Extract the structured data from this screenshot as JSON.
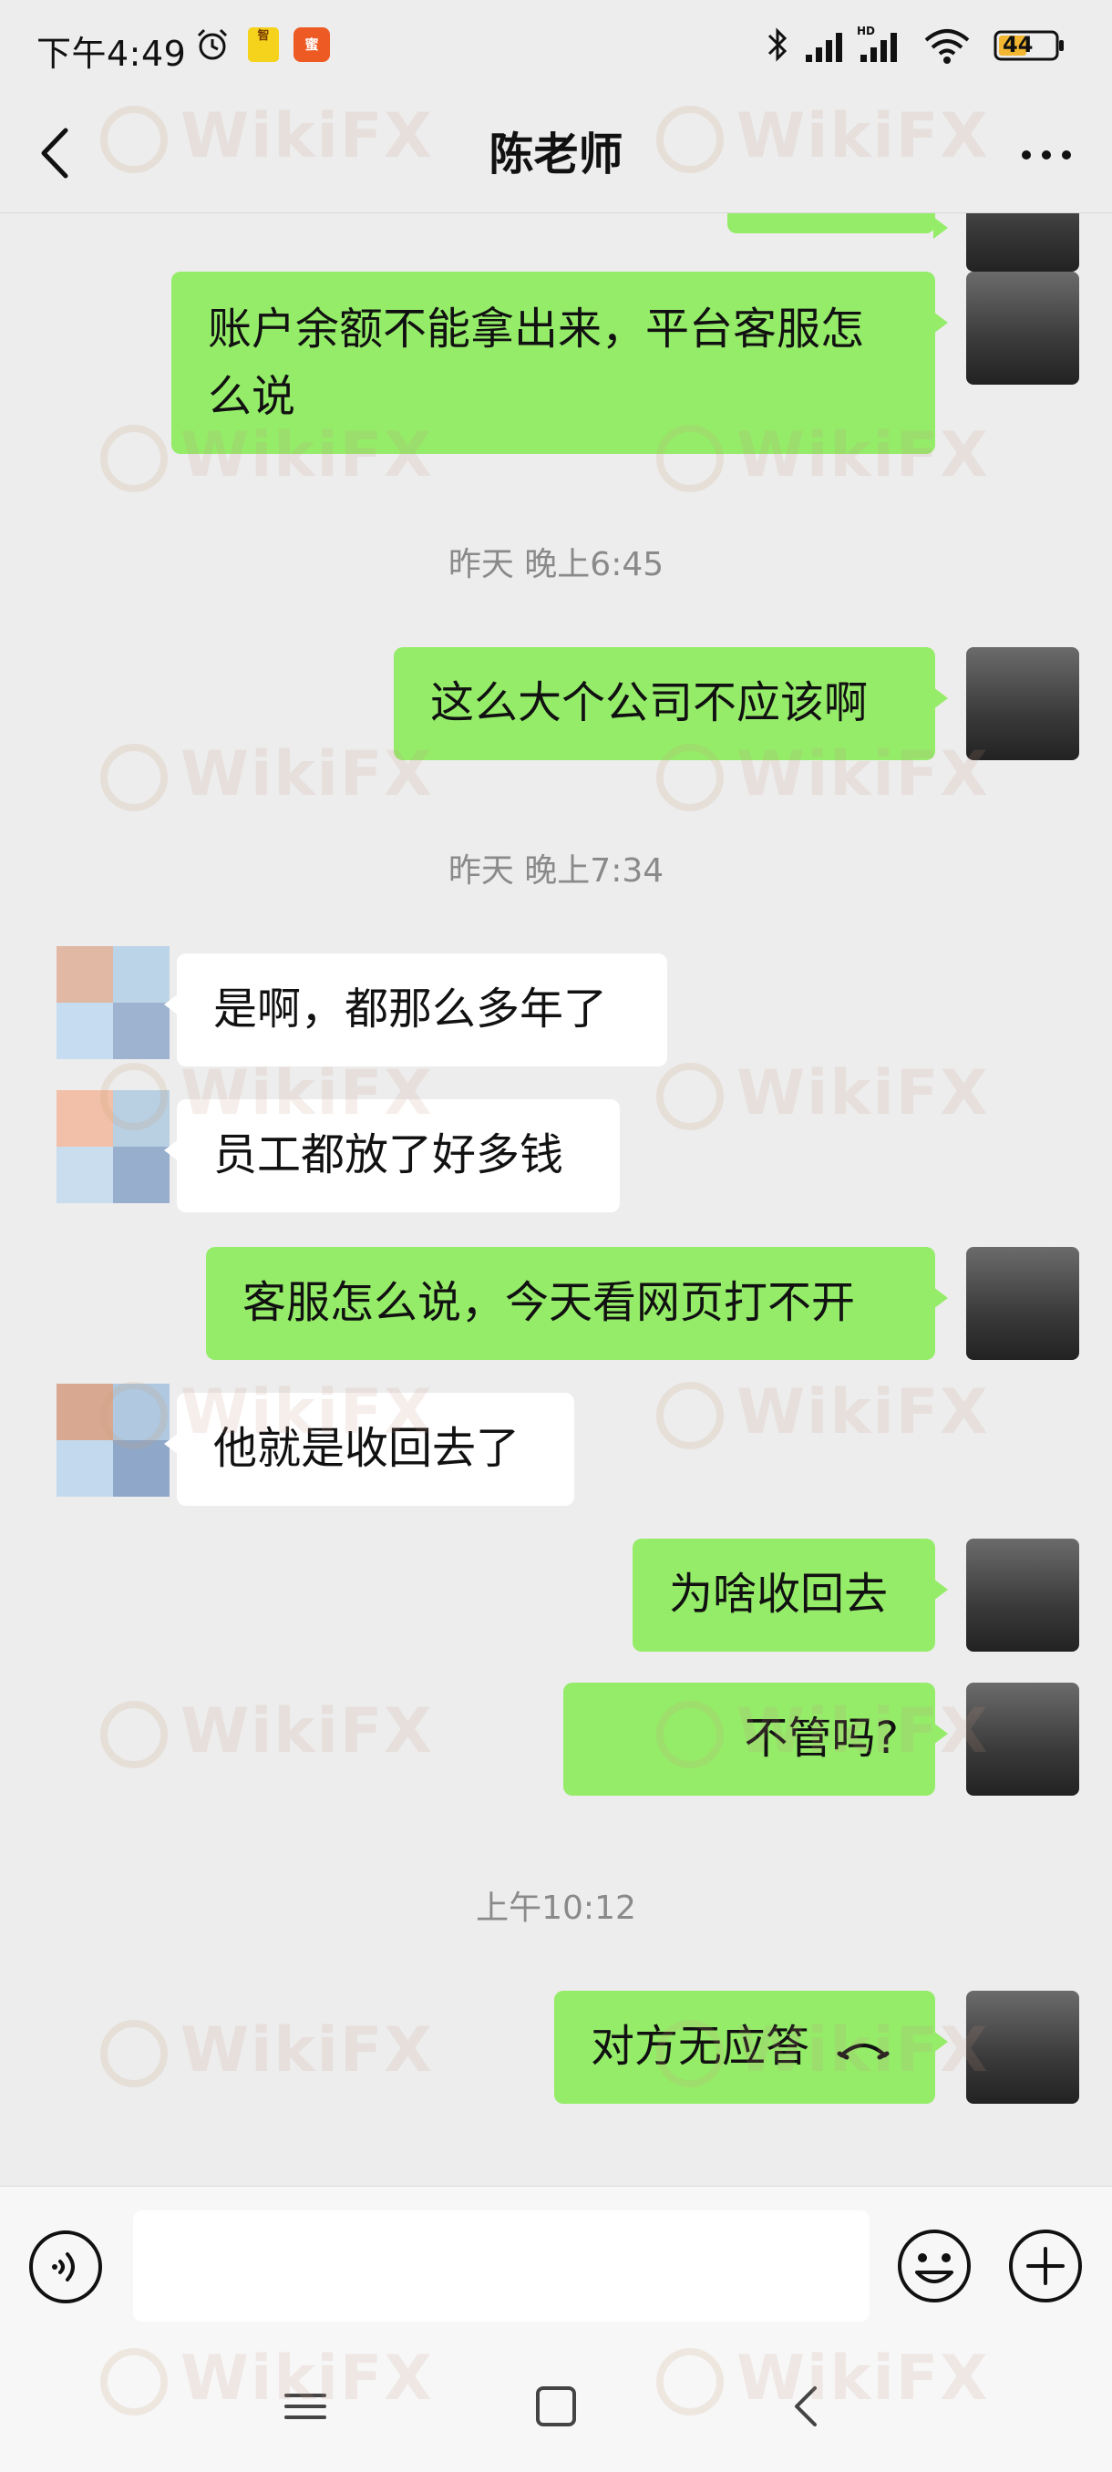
{
  "status_bar": {
    "time": "下午4:49",
    "app_badge_a": "智",
    "app_badge_b": "蜜",
    "battery": "44"
  },
  "header": {
    "title": "陈老师"
  },
  "messages": [
    {
      "from": "me",
      "text_line1": "账户余额不能拿出来，平台客服怎",
      "text_line2": "么说"
    },
    {
      "time": "昨天 晚上6:45"
    },
    {
      "from": "me",
      "text": "这么大个公司不应该啊"
    },
    {
      "time": "昨天 晚上7:34"
    },
    {
      "from": "other",
      "text": "是啊，都那么多年了"
    },
    {
      "from": "other",
      "text": "员工都放了好多钱"
    },
    {
      "from": "me",
      "text": "客服怎么说，今天看网页打不开"
    },
    {
      "from": "other",
      "text": "他就是收回去了"
    },
    {
      "from": "me",
      "text": "为啥收回去"
    },
    {
      "from": "me",
      "text": "不管吗?"
    },
    {
      "time": "上午10:12"
    },
    {
      "from": "me",
      "text": "对方无应答",
      "icon": "hangup-icon"
    }
  ],
  "input_bar": {
    "placeholder": ""
  },
  "watermark": "WikiFX",
  "colors": {
    "my_bubble": "#95ec69",
    "other_bubble": "#ffffff",
    "background": "#ededed"
  }
}
